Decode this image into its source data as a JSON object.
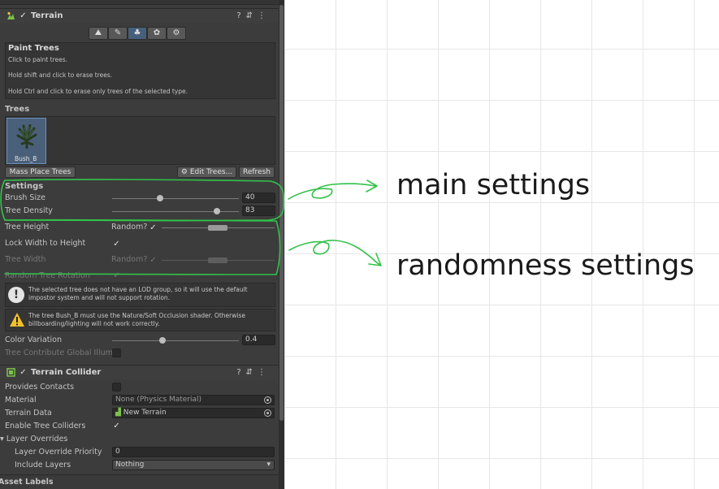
{
  "terrain": {
    "title": "Terrain",
    "tools": [
      "raise-lower-icon",
      "paint-texture-icon",
      "paint-trees-icon",
      "paint-details-icon",
      "terrain-settings-icon"
    ],
    "help": {
      "title": "Paint Trees",
      "line1": "Click to paint trees.",
      "line2": "Hold shift and click to erase trees.",
      "line3": "Hold Ctrl and click to erase only trees of the selected type."
    },
    "trees_label": "Trees",
    "tree_item": "Bush_B",
    "mass_place": "Mass Place Trees",
    "edit_trees": "Edit Trees...",
    "refresh": "Refresh",
    "settings_label": "Settings",
    "brush_size_label": "Brush Size",
    "brush_size": "40",
    "brush_size_value": 0.38,
    "tree_density_label": "Tree Density",
    "tree_density": "83",
    "tree_density_value": 0.83,
    "tree_height_label": "Tree Height",
    "random_label": "Random?",
    "lock_width_label": "Lock Width to Height",
    "tree_width_label": "Tree Width",
    "random_rotation_label": "Random Tree Rotation",
    "lod_warning": "The selected tree does not have an LOD group, so it will use the default impostor system and will not support rotation.",
    "shader_warning": "The tree Bush_B must use the Nature/Soft Occlusion shader. Otherwise billboarding/lighting will not work correctly.",
    "color_variation_label": "Color Variation",
    "color_variation": "0.4",
    "color_variation_value": 0.4,
    "global_illum_label": "Tree Contribute Global Illumi"
  },
  "collider": {
    "title": "Terrain Collider",
    "provides_contacts": "Provides Contacts",
    "material_label": "Material",
    "material_value": "None (Physics Material)",
    "terrain_data_label": "Terrain Data",
    "terrain_data_value": "New Terrain",
    "enable_colliders": "Enable Tree Colliders",
    "layer_overrides": "Layer Overrides",
    "priority_label": "Layer Override Priority",
    "priority_value": "0",
    "include_layers_label": "Include Layers",
    "include_layers_value": "Nothing"
  },
  "asset_labels": "Asset Labels",
  "annotations": {
    "main": "main settings",
    "randomness": "randomness settings",
    "stroke_color": "#33c24a"
  }
}
